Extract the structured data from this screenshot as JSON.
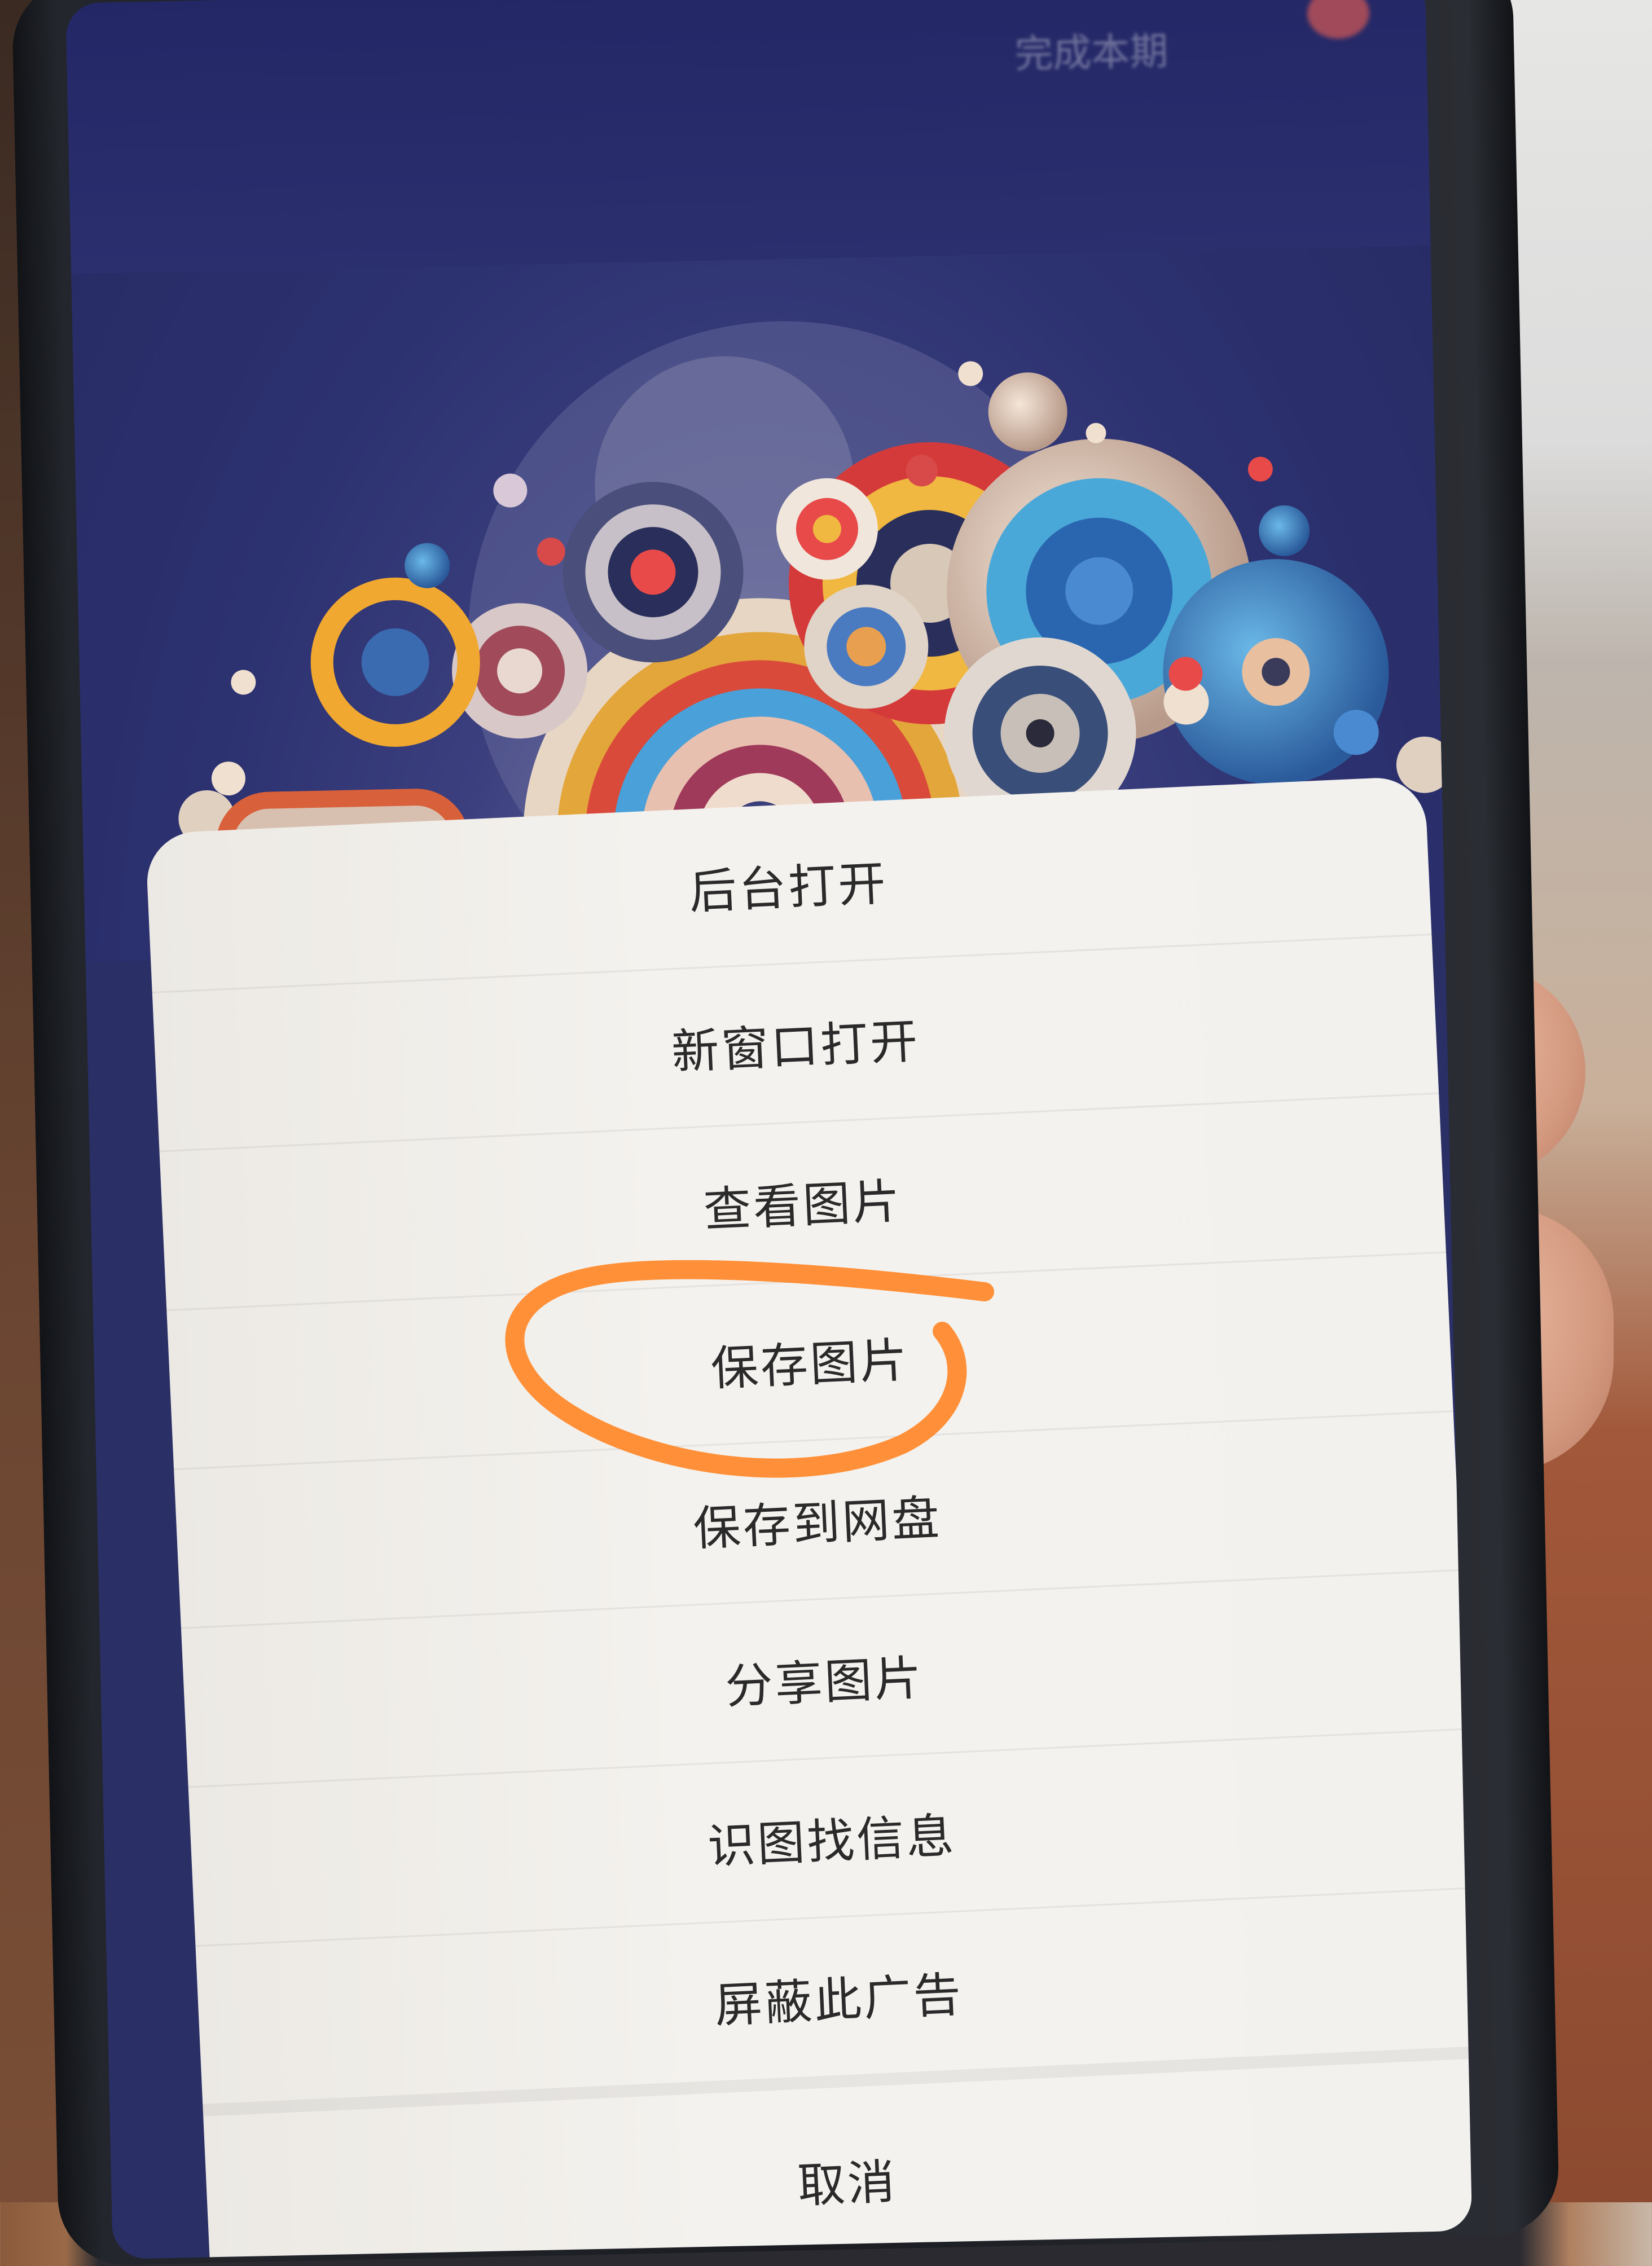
{
  "topbar": {
    "label": "完成本期"
  },
  "context_menu": {
    "items": [
      {
        "label": "后台打开"
      },
      {
        "label": "新窗口打开"
      },
      {
        "label": "查看图片"
      },
      {
        "label": "保存图片"
      },
      {
        "label": "保存到网盘"
      },
      {
        "label": "分享图片"
      },
      {
        "label": "识图找信息"
      },
      {
        "label": "屏蔽此广告"
      }
    ],
    "cancel_label": "取消"
  },
  "colors": {
    "annotation_circle": "#ff8a2e",
    "sheet_background": "#f2f1ee",
    "menu_text": "#2a2a2a",
    "wallpaper": "#2c3170"
  },
  "highlighted_item": "保存图片"
}
